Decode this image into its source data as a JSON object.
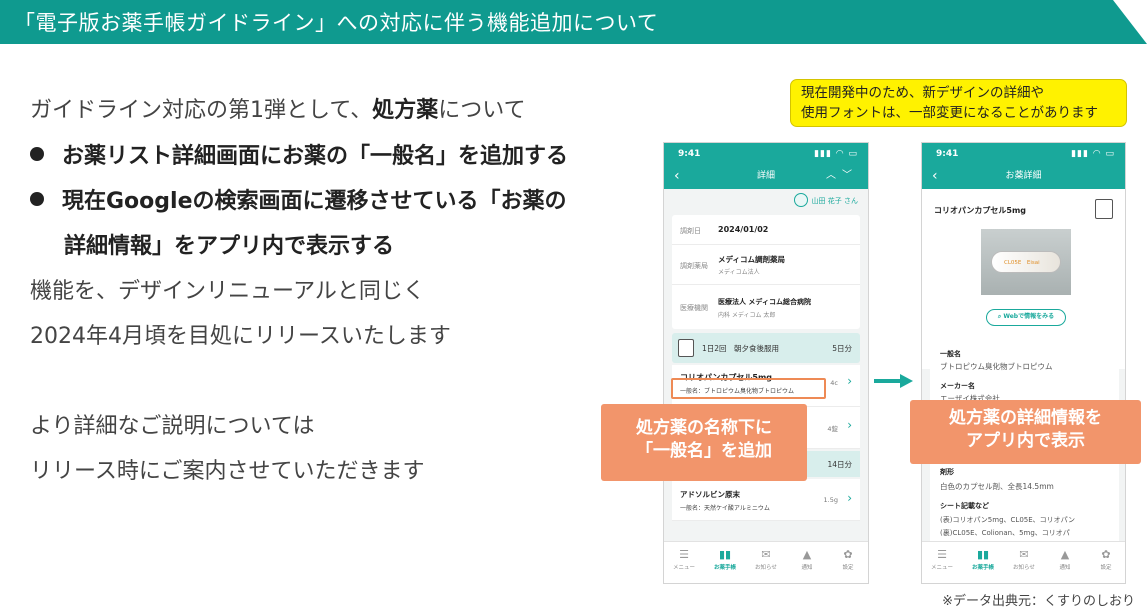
{
  "header": {
    "title": "「電子版お薬手帳ガイドライン」への対応に伴う機能追加について"
  },
  "intro": {
    "pre": "ガイドライン対応の第1弾として、",
    "bold": "処方薬",
    "post": "について"
  },
  "bullets": [
    "お薬リスト詳細画面にお薬の「一般名」を追加する",
    "現在Googleの検索画面に遷移させている「お薬の",
    "詳細情報」をアプリ内で表示する"
  ],
  "paragraphs": [
    "機能を、デザインリニューアルと同じく",
    "2024年4月頃を目処にリリースいたします",
    "より詳細なご説明については",
    "リリース時にご案内させていただきます"
  ],
  "notice": {
    "line1": "現在開発中のため、新デザインの詳細や",
    "line2": "使用フォントは、一部変更になることがあります"
  },
  "phone1": {
    "time": "9:41",
    "nav_title": "詳細",
    "user": "山田 花子 さん",
    "rows": [
      {
        "label": "調剤日",
        "value": "2024/01/02",
        "sub": ""
      },
      {
        "label": "調剤薬局",
        "value": "メディコム調剤薬局",
        "sub": "メディコム法人"
      },
      {
        "label": "医療機関",
        "value": "医療法人 メディコム総合病院",
        "sub": "内科 メディコム 太郎"
      }
    ],
    "dose_text": "1日2回　朝夕食後服用",
    "dose_days": "5日分",
    "med1_name": "コリオパンカプセル5mg",
    "med1_generic": "一般名：ブトロピウム臭化物ブトロピウム",
    "med1_qty": "4c",
    "med2_qty": "4錠",
    "dose2_days": "14日分",
    "med3_name": "アドソルビン原末",
    "med3_generic": "一般名：天然ケイ酸アルミニウム",
    "med3_qty": "1.5g"
  },
  "phone2": {
    "time": "9:41",
    "nav_title": "お薬詳細",
    "drug_name": "コリオパンカプセル5mg",
    "capsule_text": "CL05E　Eisai",
    "web_button": "Webで情報をみる",
    "generic_label": "一般名",
    "generic_value": "ブトロピウム臭化物ブトロピウム",
    "maker_label": "メーカー名",
    "maker_value": "エーザイ株式会社",
    "shape_label": "剤形",
    "shape_value": "白色のカプセル剤、全長14.5mm",
    "imprint_label": "シート記載など",
    "imprint_value1": "(表)コリオパン5mg、CL05E、コリオパン",
    "imprint_value2": "(裏)CL05E、Colionan、5mg、コリオパ"
  },
  "tabs": [
    "メニュー",
    "お薬手帳",
    "お知らせ",
    "通知",
    "設定"
  ],
  "callout1": {
    "line1": "処方薬の名称下に",
    "line2": "「一般名」を追加"
  },
  "callout2": {
    "line1": "処方薬の詳細情報を",
    "line2": "アプリ内で表示"
  },
  "credit": "※データ出典元：くすりのしおり",
  "colors": {
    "header": "#0f9a8f",
    "accent": "#1aa99c",
    "callout": "#f2956b",
    "notice": "#fff200"
  },
  "icons": {
    "tab_menu": "hamburger-icon",
    "tab_notebook": "book-icon",
    "tab_mail": "mail-icon",
    "tab_bell": "bell-icon",
    "tab_settings": "gear-icon"
  }
}
